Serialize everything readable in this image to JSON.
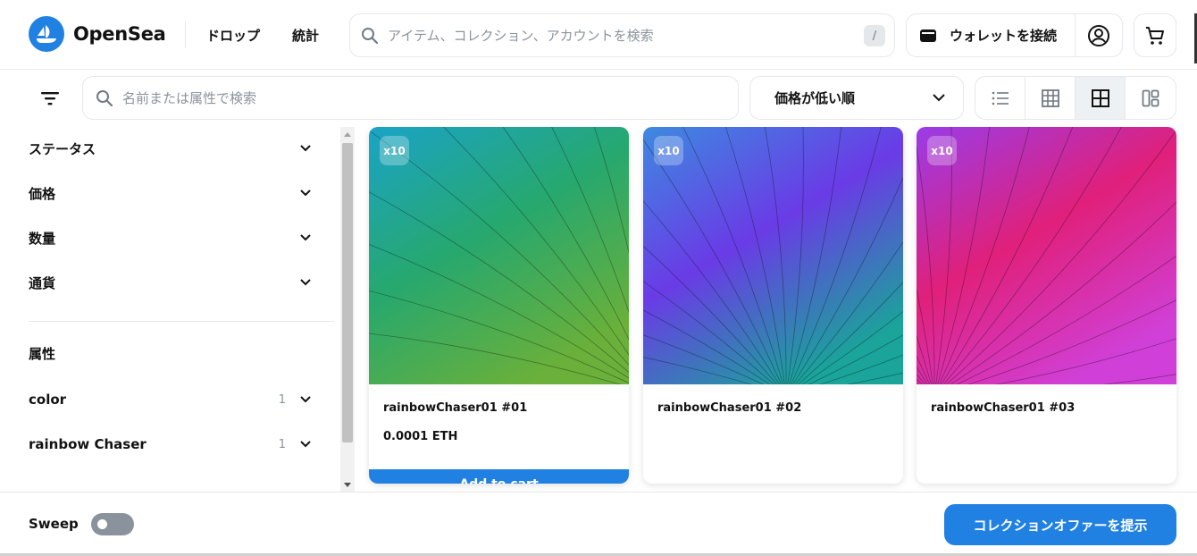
{
  "header": {
    "brand": "OpenSea",
    "nav": [
      {
        "label": "ドロップ"
      },
      {
        "label": "統計"
      }
    ],
    "search_placeholder": "アイテム、コレクション、アカウントを検索",
    "search_shortcut": "/",
    "wallet_label": "ウォレットを接続",
    "icons": [
      "opensea-logo-icon",
      "search-icon",
      "wallet-icon",
      "account-icon",
      "cart-icon"
    ]
  },
  "toolbar": {
    "search_placeholder": "名前または属性で検索",
    "sort_label": "価格が低い順",
    "view_modes": [
      "list-view-icon",
      "large-grid-icon",
      "grid-view-icon",
      "gallery-view-icon"
    ],
    "active_view": "grid-view-icon"
  },
  "sidebar": {
    "filters": [
      {
        "label": "ステータス"
      },
      {
        "label": "価格"
      },
      {
        "label": "数量"
      },
      {
        "label": "通貨"
      }
    ],
    "traits_heading": "属性",
    "traits": [
      {
        "label": "color",
        "count": "1"
      },
      {
        "label": "rainbow Chaser",
        "count": "1"
      }
    ]
  },
  "items": [
    {
      "name": "rainbowChaser01 #01",
      "badge": "x10",
      "price": "0.0001 ETH",
      "button": "Add to cart",
      "colors": [
        "#1aa3c7",
        "#27a86e",
        "#6ab03a"
      ]
    },
    {
      "name": "rainbowChaser01 #02",
      "badge": "x10",
      "colors": [
        "#3d8ae0",
        "#6a3be6",
        "#1aa49a"
      ]
    },
    {
      "name": "rainbowChaser01 #03",
      "badge": "x10",
      "colors": [
        "#9a3ce8",
        "#e0207a",
        "#d040d8"
      ]
    }
  ],
  "footer": {
    "sweep_label": "Sweep",
    "sweep_enabled": false,
    "offer_button": "コレクションオファーを提示"
  }
}
